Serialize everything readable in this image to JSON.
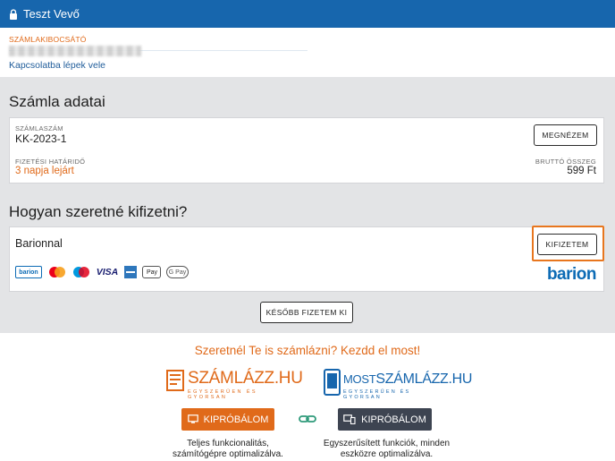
{
  "header": {
    "user_name": "Teszt Vevő"
  },
  "issuer": {
    "label": "SZÁMLAKIBOCSÁTÓ",
    "contact_link": "Kapcsolatba lépek vele"
  },
  "invoice_section": {
    "title": "Számla adatai",
    "number_label": "SZÁMLASZÁM",
    "number_value": "KK-2023-1",
    "view_button": "MEGNÉZEM",
    "due_label": "FIZETÉSI HATÁRIDŐ",
    "due_value": "3 napja lejárt",
    "gross_label": "BRUTTÓ ÖSSZEG",
    "gross_value": "599 Ft"
  },
  "payment_section": {
    "title": "Hogyan szeretné kifizetni?",
    "method_name": "Barionnal",
    "pay_button": "KIFIZETEM",
    "card_labels": {
      "barion": "barion",
      "visa": "VISA",
      "apple_pay": "Pay",
      "google_pay": "G Pay"
    },
    "brand_logo": "barion",
    "later_button": "KÉSŐBB FIZETEM KI"
  },
  "promo": {
    "headline": "Szeretnél Te is számlázni? Kezdd el most!",
    "szamlazz": {
      "logo_text": "SZÁMLÁZZ.HU",
      "logo_tagline": "EGYSZERŰEN ÉS GYORSAN",
      "button": "KIPRÓBÁLOM",
      "desc_line1": "Teljes funkcionalitás,",
      "desc_line2": "számítógépre optimalizálva."
    },
    "most": {
      "logo_prefix": "MOST",
      "logo_text": "SZÁMLÁZZ.HU",
      "logo_tagline": "EGYSZERŰEN ÉS GYORSAN",
      "button": "KIPRÓBÁLOM",
      "desc_line1": "Egyszerűsített funkciók, minden",
      "desc_line2": "eszközre optimalizálva."
    }
  },
  "colors": {
    "header": "#1766ad",
    "accent_orange": "#e06a1a",
    "highlight": "#e8761e",
    "dark_button": "#3d4451",
    "barion_blue": "#0c6bb5"
  }
}
